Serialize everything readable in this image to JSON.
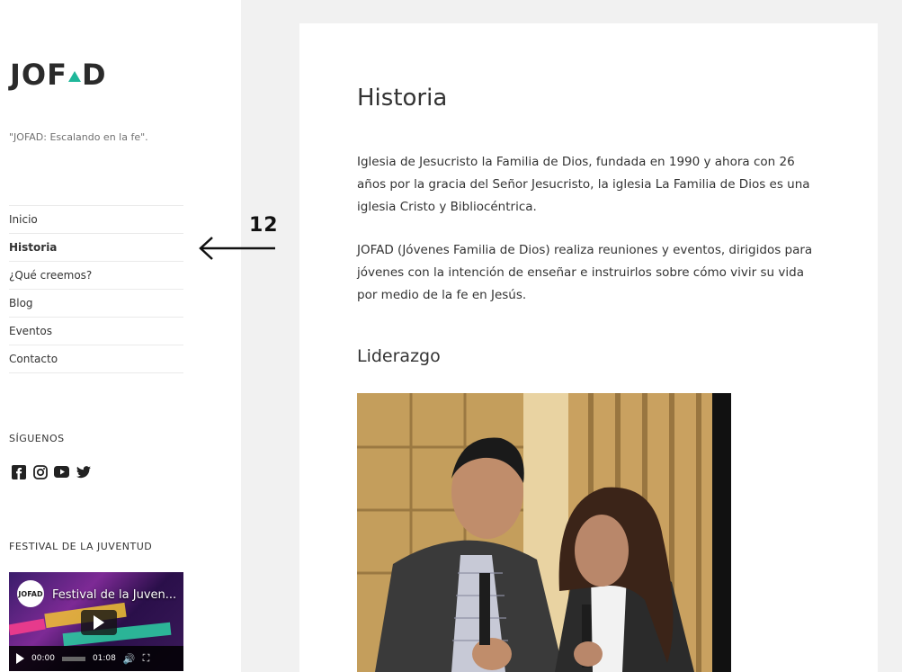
{
  "site": {
    "logo_text_left": "JOF",
    "logo_text_right": "D",
    "tagline": "\"JOFAD: Escalando en la fe\"."
  },
  "menu": {
    "items": [
      {
        "label": "Inicio",
        "active": false
      },
      {
        "label": "Historia",
        "active": true
      },
      {
        "label": "¿Qué creemos?",
        "active": false
      },
      {
        "label": "Blog",
        "active": false
      },
      {
        "label": "Eventos",
        "active": false
      },
      {
        "label": "Contacto",
        "active": false
      }
    ]
  },
  "annotation": {
    "number": "12"
  },
  "social_widget": {
    "title": "SÍGUENOS",
    "icons": [
      "facebook-icon",
      "instagram-icon",
      "youtube-icon",
      "twitter-icon"
    ]
  },
  "festival_widget": {
    "title": "FESTIVAL DE LA JUVENTUD",
    "video_title": "Festival de la Juven...",
    "channel_label": "JOFAD",
    "current_time": "00:00",
    "duration": "01:08"
  },
  "article": {
    "title": "Historia",
    "paragraph1": "Iglesia de Jesucristo la Familia de Dios, fundada en 1990 y ahora con 26 años por la gracia del Señor Jesucristo, la iglesia La Familia de Dios es una iglesia Cristo y Bibliocéntrica.",
    "paragraph2": "JOFAD (Jóvenes Familia de Dios) realiza reuniones y eventos, dirigidos para jóvenes con la intención de enseñar e instruirlos sobre cómo vivir su vida por medio de la fe en Jesús.",
    "section_title": "Liderazgo"
  },
  "colors": {
    "accent": "#1fb79a",
    "background": "#f1f1f1"
  }
}
